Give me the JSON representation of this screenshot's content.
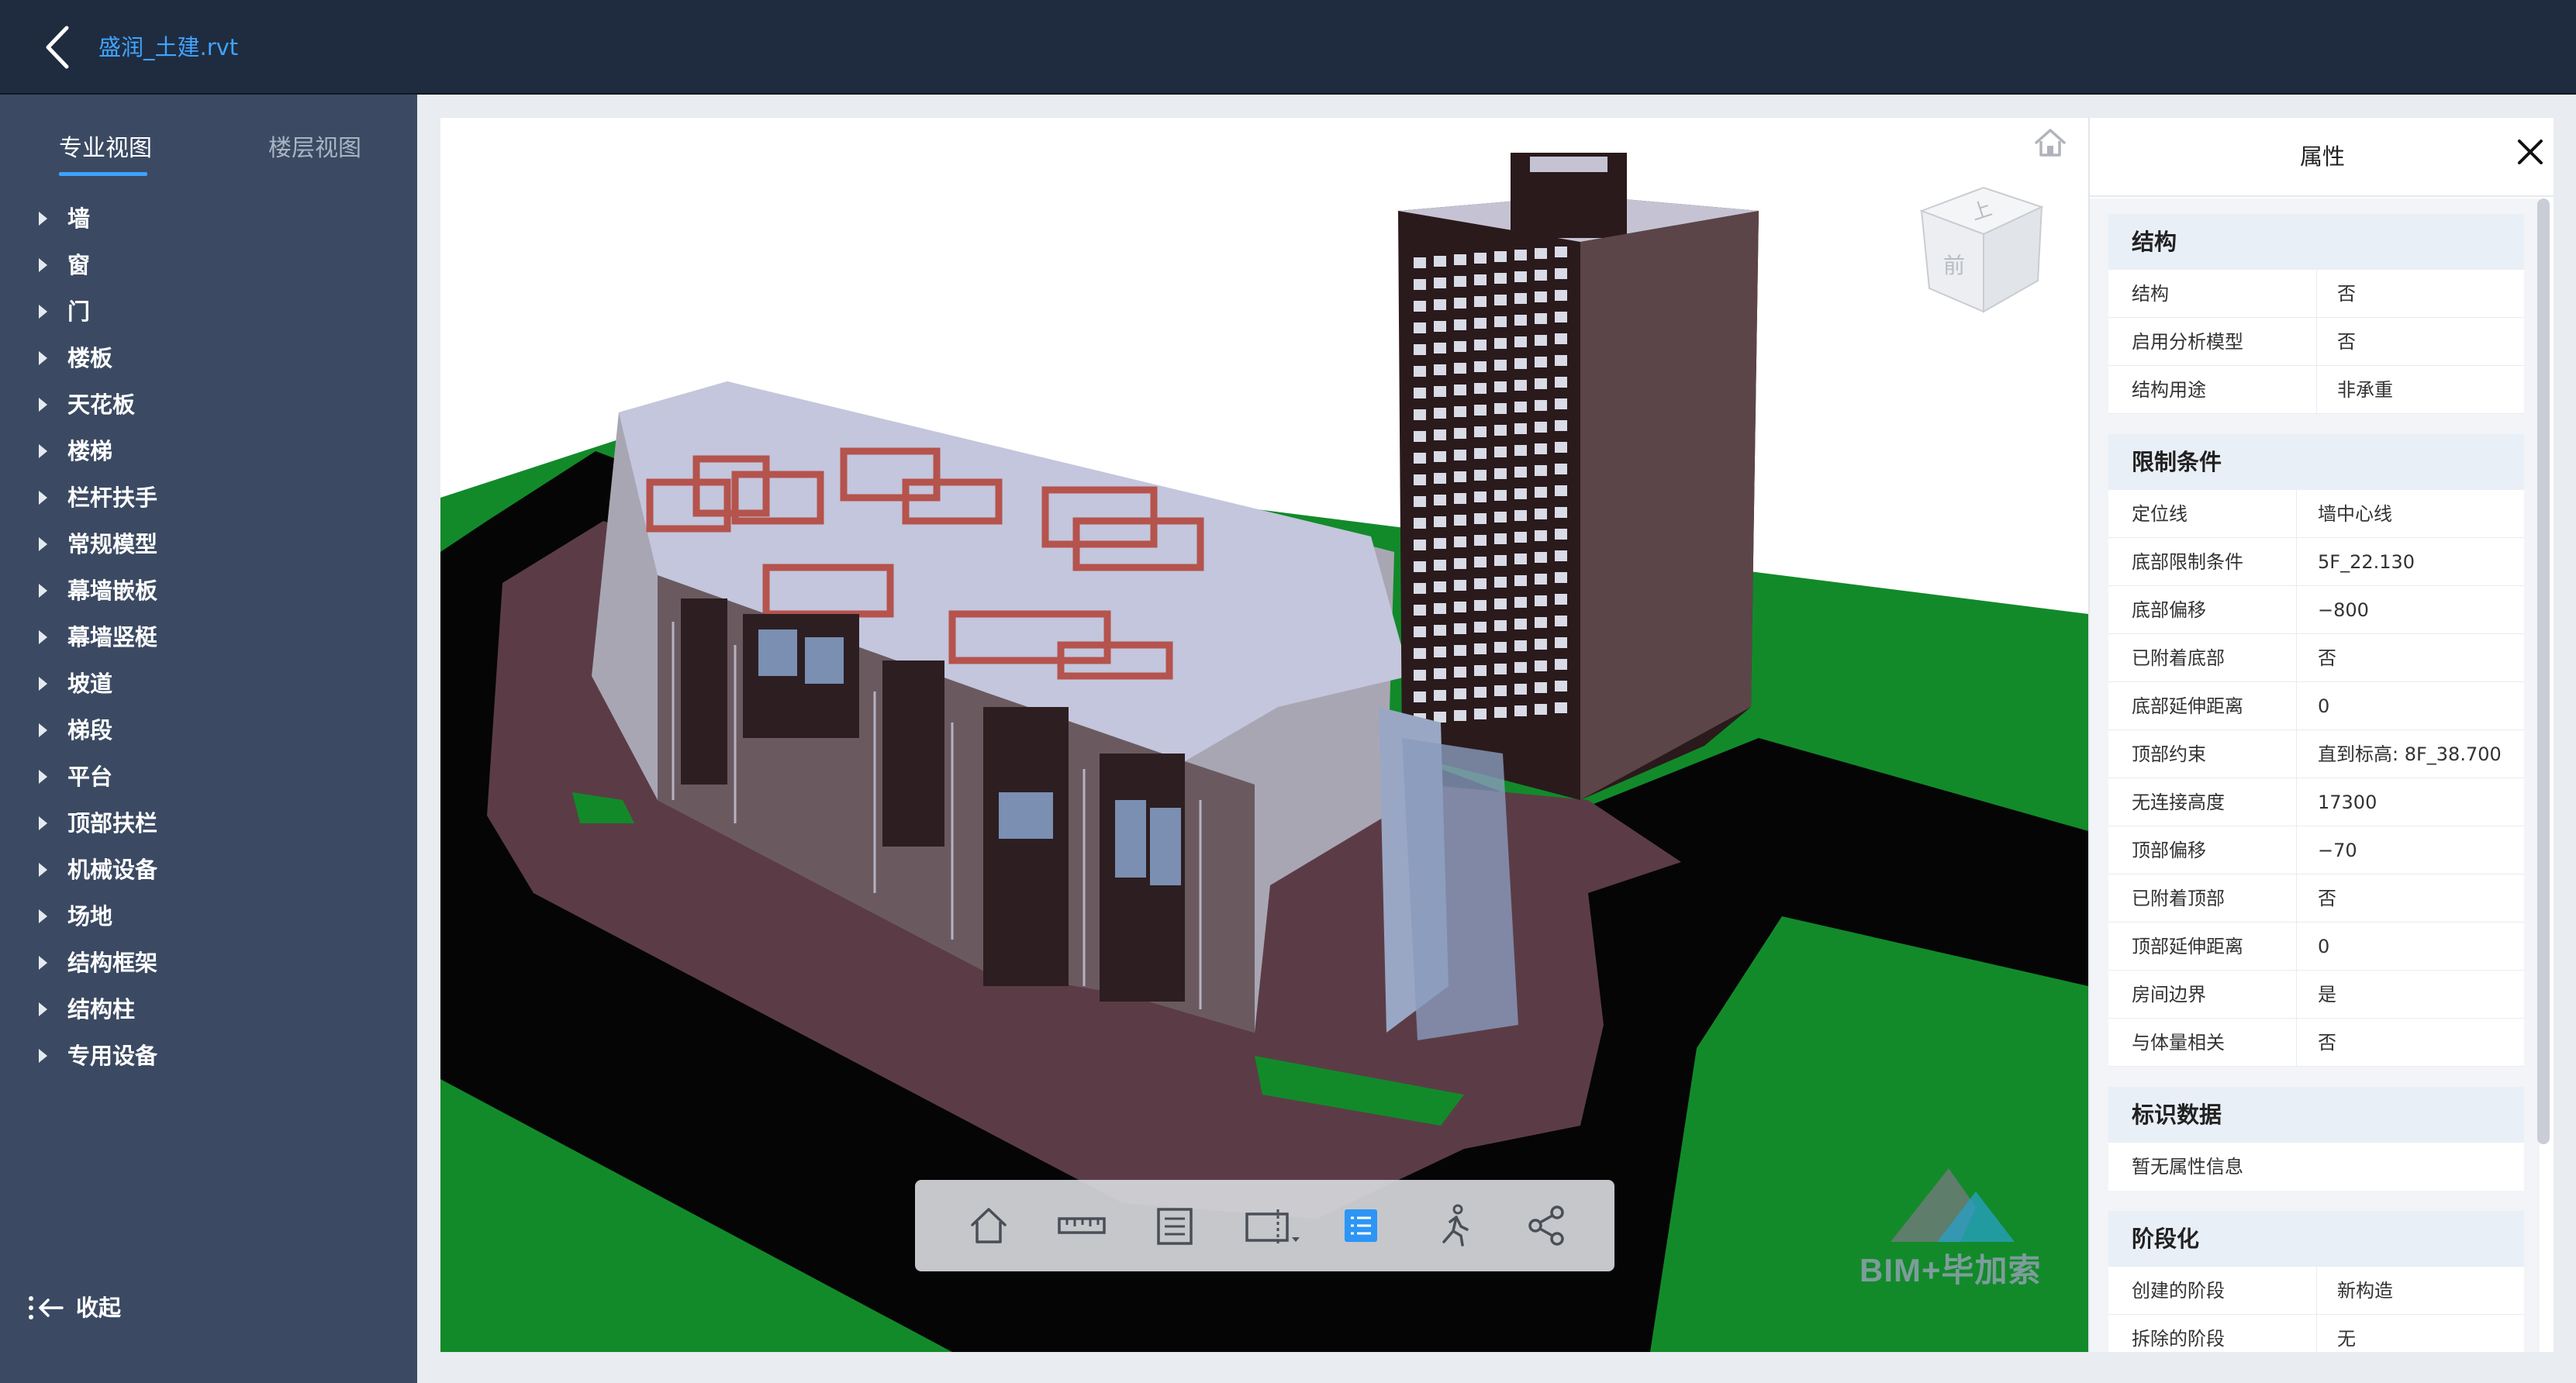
{
  "header": {
    "file_name": "盛润_土建.rvt"
  },
  "sidebar": {
    "tabs": [
      {
        "label": "专业视图",
        "active": true
      },
      {
        "label": "楼层视图",
        "active": false
      }
    ],
    "items": [
      {
        "label": "墙"
      },
      {
        "label": "窗"
      },
      {
        "label": "门"
      },
      {
        "label": "楼板"
      },
      {
        "label": "天花板"
      },
      {
        "label": "楼梯"
      },
      {
        "label": "栏杆扶手"
      },
      {
        "label": "常规模型"
      },
      {
        "label": "幕墙嵌板"
      },
      {
        "label": "幕墙竖梃"
      },
      {
        "label": "坡道"
      },
      {
        "label": "梯段"
      },
      {
        "label": "平台"
      },
      {
        "label": "顶部扶栏"
      },
      {
        "label": "机械设备"
      },
      {
        "label": "场地"
      },
      {
        "label": "结构框架"
      },
      {
        "label": "结构柱"
      },
      {
        "label": "专用设备"
      }
    ],
    "collapse_label": "收起"
  },
  "viewer": {
    "viewcube": {
      "top_label": "上",
      "front_label": "前"
    },
    "toolbar": [
      {
        "icon": "home-icon",
        "active": false
      },
      {
        "icon": "ruler-icon",
        "active": false
      },
      {
        "icon": "list-doc-icon",
        "active": false
      },
      {
        "icon": "section-box-icon",
        "active": false
      },
      {
        "icon": "properties-icon",
        "active": true
      },
      {
        "icon": "walk-icon",
        "active": false
      },
      {
        "icon": "share-icon",
        "active": false
      }
    ],
    "watermark": "BIM+毕加索",
    "accent_color": "#3fa3ff"
  },
  "properties": {
    "title": "属性",
    "groups": [
      {
        "name": "结构",
        "rows": [
          {
            "key": "结构",
            "value": "否"
          },
          {
            "key": "启用分析模型",
            "value": "否"
          },
          {
            "key": "结构用途",
            "value": "非承重"
          }
        ]
      },
      {
        "name": "限制条件",
        "rows": [
          {
            "key": "定位线",
            "value": "墙中心线"
          },
          {
            "key": "底部限制条件",
            "value": "5F_22.130"
          },
          {
            "key": "底部偏移",
            "value": "−800"
          },
          {
            "key": "已附着底部",
            "value": "否"
          },
          {
            "key": "底部延伸距离",
            "value": "0"
          },
          {
            "key": "顶部约束",
            "value": "直到标高: 8F_38.700"
          },
          {
            "key": "无连接高度",
            "value": "17300"
          },
          {
            "key": "顶部偏移",
            "value": "−70"
          },
          {
            "key": "已附着顶部",
            "value": "否"
          },
          {
            "key": "顶部延伸距离",
            "value": "0"
          },
          {
            "key": "房间边界",
            "value": "是"
          },
          {
            "key": "与体量相关",
            "value": "否"
          }
        ]
      },
      {
        "name": "标识数据",
        "empty_text": "暂无属性信息",
        "rows": []
      },
      {
        "name": "阶段化",
        "rows": [
          {
            "key": "创建的阶段",
            "value": "新构造"
          },
          {
            "key": "拆除的阶段",
            "value": "无"
          }
        ]
      }
    ]
  }
}
